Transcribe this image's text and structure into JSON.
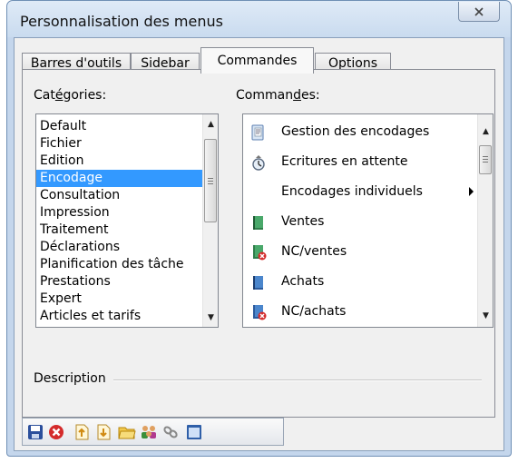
{
  "window": {
    "title": "Personnalisation des menus"
  },
  "tabs": [
    {
      "label": "Barres d'outils"
    },
    {
      "label": "Sidebar"
    },
    {
      "label": "Commandes"
    },
    {
      "label": "Options"
    }
  ],
  "categories": {
    "label_pre": "Cat",
    "label_ul": "é",
    "label_post": "gories:",
    "items": [
      "Default",
      "Fichier",
      "Edition",
      "Encodage",
      "Consultation",
      "Impression",
      "Traitement",
      "Déclarations",
      "Planification des tâche",
      "Prestations",
      "Expert",
      "Articles et tarifs"
    ],
    "selected": "Encodage"
  },
  "commands": {
    "label_pre": "Comman",
    "label_ul": "d",
    "label_post": "es:",
    "items": [
      {
        "label": "Gestion des encodages",
        "icon": "document-book-icon"
      },
      {
        "label": "Ecritures en attente",
        "icon": "hourglass-icon"
      },
      {
        "label": "Encodages individuels",
        "icon": "",
        "submenu": true
      },
      {
        "label": "Ventes",
        "icon": "green-book-icon"
      },
      {
        "label": "NC/ventes",
        "icon": "green-book-red-icon"
      },
      {
        "label": "Achats",
        "icon": "blue-book-icon"
      },
      {
        "label": "NC/achats",
        "icon": "blue-book-red-icon"
      }
    ]
  },
  "description": {
    "label": "Description"
  },
  "toolbar": {
    "buttons": [
      "save-icon",
      "delete-icon",
      "export-icon",
      "import-icon",
      "open-folder-icon",
      "users-icon",
      "link-icon",
      "window-icon"
    ]
  },
  "colors": {
    "selection": "#3399ff",
    "window_frame": "#c4d6ec"
  }
}
